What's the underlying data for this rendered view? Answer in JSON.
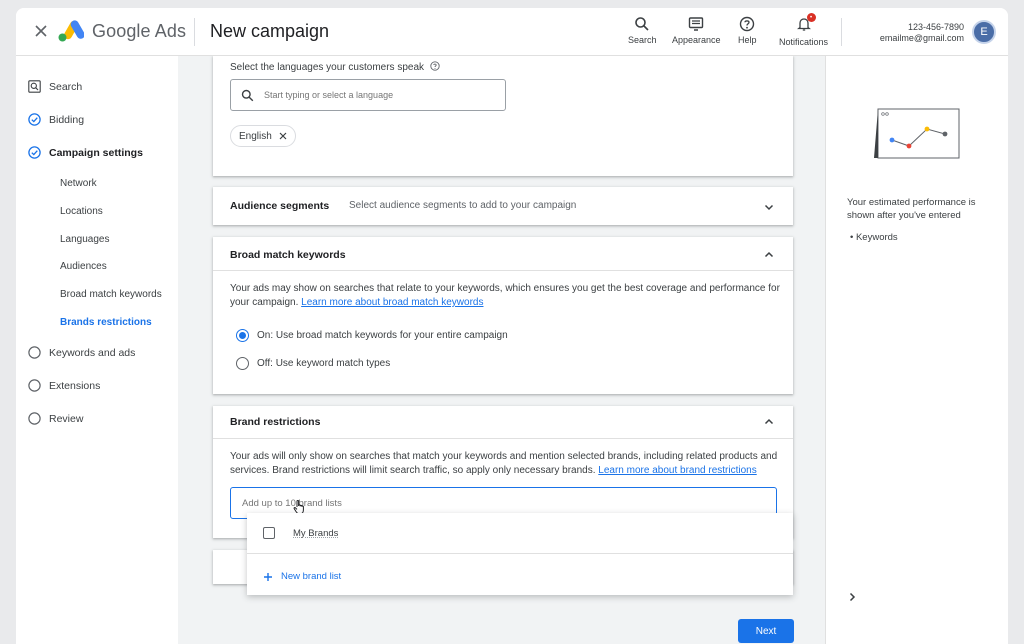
{
  "header": {
    "close_label": "×",
    "brand": "Google Ads",
    "title": "New campaign",
    "actions": [
      {
        "label": "Search",
        "icon": "search-icon"
      },
      {
        "label": "Appearance",
        "icon": "appearance-icon"
      },
      {
        "label": "Help",
        "icon": "help-icon"
      },
      {
        "label": "Notifications",
        "icon": "bell-icon",
        "badge": "•"
      }
    ],
    "account_id": "123-456-7890",
    "account_email": "emailme@gmail.com",
    "avatar_letter": "E"
  },
  "sidebar": {
    "items": [
      {
        "label": "Search",
        "icon": "search-campaign-icon"
      },
      {
        "label": "Bidding",
        "icon": "check-circle-icon"
      },
      {
        "label": "Campaign settings",
        "icon": "check-circle-icon"
      },
      {
        "label": "Keywords and ads",
        "icon": "empty-circle-icon"
      },
      {
        "label": "Extensions",
        "icon": "empty-circle-icon"
      },
      {
        "label": "Review",
        "icon": "empty-circle-icon"
      }
    ],
    "sub_items": [
      "Network",
      "Locations",
      "Languages",
      "Audiences",
      "Broad match keywords",
      "Brands restrictions"
    ]
  },
  "languages": {
    "prompt": "Select the languages your customers speak",
    "placeholder": "Start typing or select a language",
    "chip": "English"
  },
  "audience": {
    "title": "Audience segments",
    "hint": "Select audience segments to add to your campaign"
  },
  "broad_match": {
    "title": "Broad match keywords",
    "description": "Your ads may show on searches that relate to your keywords, which ensures you get the best coverage and performance for your campaign.",
    "link": "Learn more about broad match keywords",
    "option_on": "On: Use broad match keywords for your entire campaign",
    "option_off": "Off: Use keyword match types"
  },
  "brand_restrictions": {
    "title": "Brand restrictions",
    "description": "Your ads will only show on searches that match your keywords and mention selected brands, including related products and services. Brand restrictions will limit search traffic, so apply only necessary brands.",
    "link": "Learn more about brand restrictions",
    "placeholder": "Add up to 10 brand lists",
    "dropdown_item": "My Brands",
    "new_list": "New brand list"
  },
  "footer": {
    "next": "Next"
  },
  "right_panel": {
    "text": "Your estimated performance is shown after you've entered",
    "bullet": "Keywords"
  },
  "colors": {
    "accent": "#1a73e8",
    "badge": "#d93025"
  }
}
